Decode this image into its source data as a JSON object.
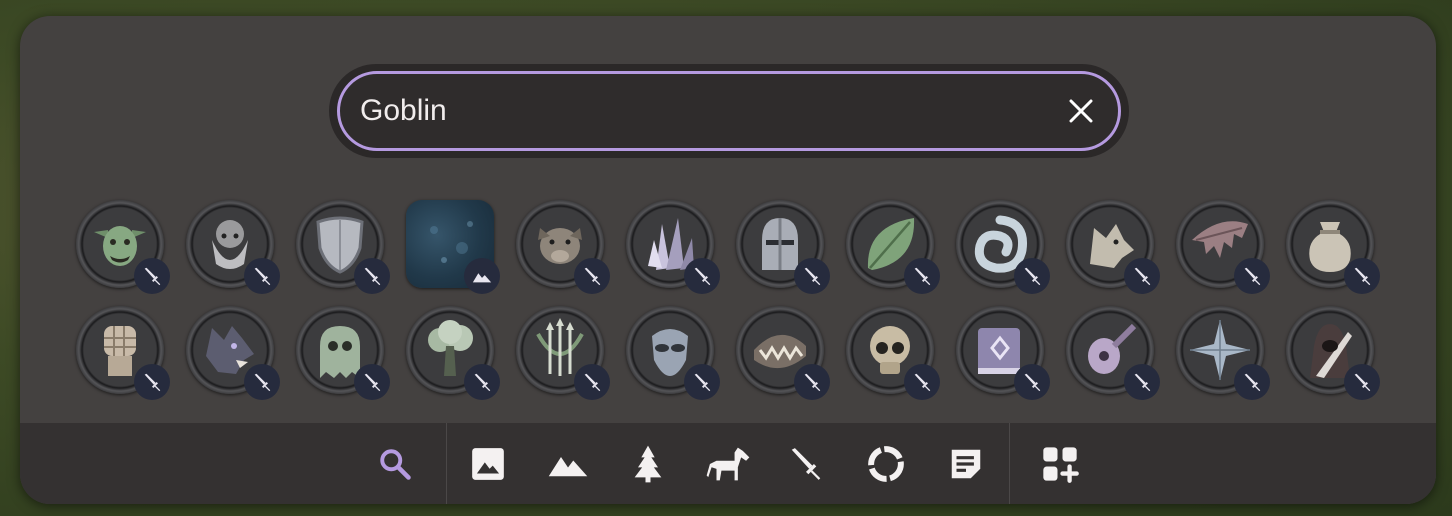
{
  "search": {
    "value": "Goblin",
    "placeholder": "",
    "accent_color": "#b59ae0"
  },
  "results": [
    {
      "icon": "goblin-face",
      "type": "character"
    },
    {
      "icon": "dwarf-face",
      "type": "character"
    },
    {
      "icon": "shield",
      "type": "character"
    },
    {
      "icon": "water-texture",
      "type": "terrain"
    },
    {
      "icon": "boar-head",
      "type": "character"
    },
    {
      "icon": "crystal-cluster",
      "type": "character"
    },
    {
      "icon": "knight-helmet",
      "type": "character"
    },
    {
      "icon": "leaf",
      "type": "character"
    },
    {
      "icon": "swirl",
      "type": "character"
    },
    {
      "icon": "wolf-head",
      "type": "character"
    },
    {
      "icon": "bat-wing",
      "type": "character"
    },
    {
      "icon": "coin-pouch",
      "type": "character"
    },
    {
      "icon": "fist",
      "type": "character"
    },
    {
      "icon": "werewolf-head",
      "type": "character"
    },
    {
      "icon": "ghost-skull",
      "type": "character"
    },
    {
      "icon": "tree",
      "type": "character"
    },
    {
      "icon": "bow-arrows",
      "type": "character"
    },
    {
      "icon": "alien-mask",
      "type": "character"
    },
    {
      "icon": "toothy-maw",
      "type": "character"
    },
    {
      "icon": "skull",
      "type": "character"
    },
    {
      "icon": "spellbook",
      "type": "character"
    },
    {
      "icon": "lute",
      "type": "character"
    },
    {
      "icon": "compass-rose",
      "type": "character"
    },
    {
      "icon": "hooded-assassin",
      "type": "character"
    }
  ],
  "toolbar": {
    "tools": [
      {
        "icon": "search-icon",
        "active": true
      },
      {
        "icon": "image-icon",
        "active": false
      },
      {
        "icon": "terrain-icon",
        "active": false
      },
      {
        "icon": "tree-icon",
        "active": false
      },
      {
        "icon": "horse-icon",
        "active": false
      },
      {
        "icon": "sword-icon",
        "active": false
      },
      {
        "icon": "ring-icon",
        "active": false
      },
      {
        "icon": "note-icon",
        "active": false
      },
      {
        "icon": "add-widget-icon",
        "active": false
      }
    ],
    "active_color": "#b59ae0",
    "icon_color": "#f4f1f1"
  }
}
